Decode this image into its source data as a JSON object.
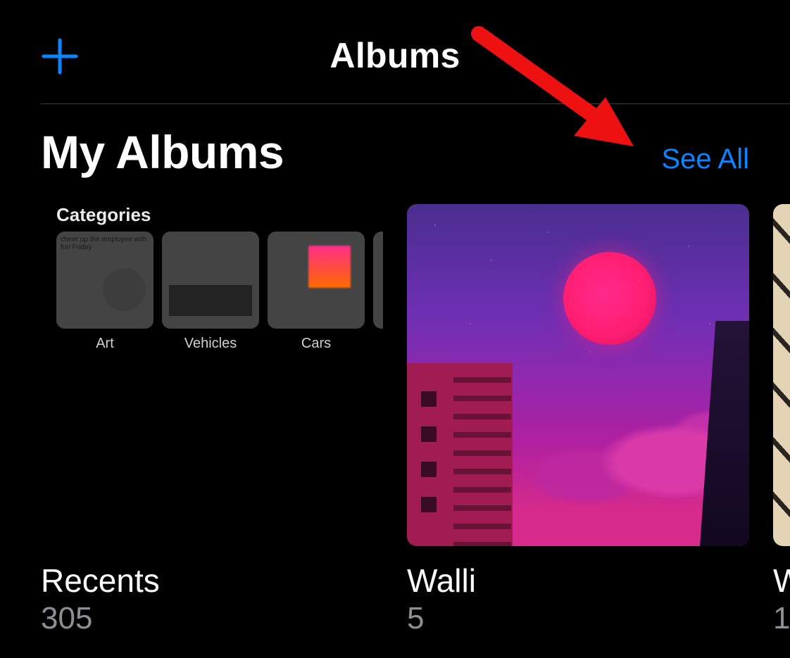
{
  "nav": {
    "title": "Albums"
  },
  "section": {
    "title": "My Albums",
    "see_all": "See All"
  },
  "albums": [
    {
      "title": "Recents",
      "count": "305",
      "categories_label": "Categories",
      "cats": [
        "Art",
        "Vehicles",
        "Cars"
      ],
      "art_caption": "cheer up the employee with fun Friday"
    },
    {
      "title": "Walli",
      "count": "5"
    },
    {
      "title": "W",
      "count": "1"
    }
  ],
  "colors": {
    "accent": "#0b84ff",
    "secondary_text": "#8e8e93"
  }
}
